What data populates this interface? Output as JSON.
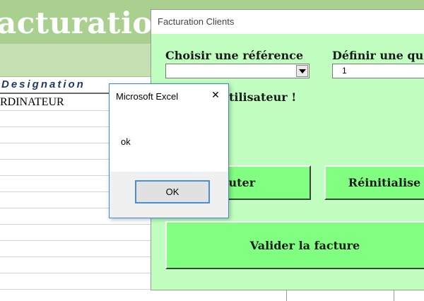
{
  "sheet": {
    "banner_title": "acturation",
    "column_header": "Designation",
    "first_row_value": "RDINATEUR"
  },
  "userform": {
    "title": "Facturation Clients",
    "reference_label": "Choisir une référence",
    "quantity_label": "Définir une qua",
    "reference_value": "",
    "quantity_value": "1",
    "message_label": "tilisateur !",
    "add_button": "outer",
    "reset_button": "Réinitialise",
    "validate_button": "Valider la facture"
  },
  "msgbox": {
    "title": "Microsoft Excel",
    "close_glyph": "✕",
    "message": "ok",
    "ok_button": "OK",
    "accent_color": "#3c8ad8"
  },
  "colors": {
    "banner": "#a9d08e",
    "band": "#c6e0b4",
    "form_background": "#c0ffc0",
    "button_green": "#80ff80"
  },
  "icons": {
    "dropdown": "chevron-down-icon",
    "close": "close-icon"
  }
}
